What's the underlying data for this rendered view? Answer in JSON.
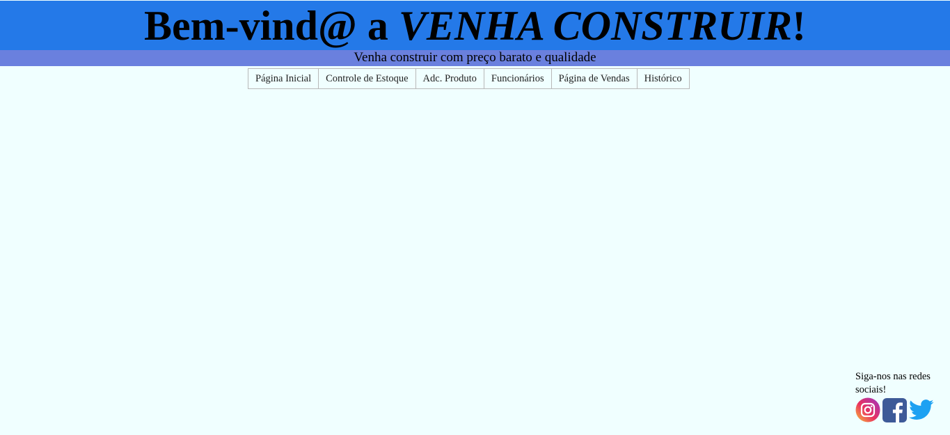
{
  "header": {
    "title_prefix": "Bem-vind@ a ",
    "title_brand": "VENHA CONSTRUIR",
    "title_suffix": "!",
    "subtitle": "Venha construir com preço barato e qualidade",
    "bg_color": "#2479e8",
    "subtitle_bg_color": "#6a80de"
  },
  "nav": {
    "items": [
      {
        "label": "Página Inicial"
      },
      {
        "label": "Controle de Estoque"
      },
      {
        "label": "Adc. Produto"
      },
      {
        "label": "Funcionários"
      },
      {
        "label": "Página de Vendas"
      },
      {
        "label": "Histórico"
      }
    ]
  },
  "social": {
    "text": "Siga-nos nas redes sociais!",
    "icons": [
      "instagram-icon",
      "facebook-icon",
      "twitter-icon"
    ]
  },
  "page": {
    "bg_color": "#f0ffff"
  }
}
